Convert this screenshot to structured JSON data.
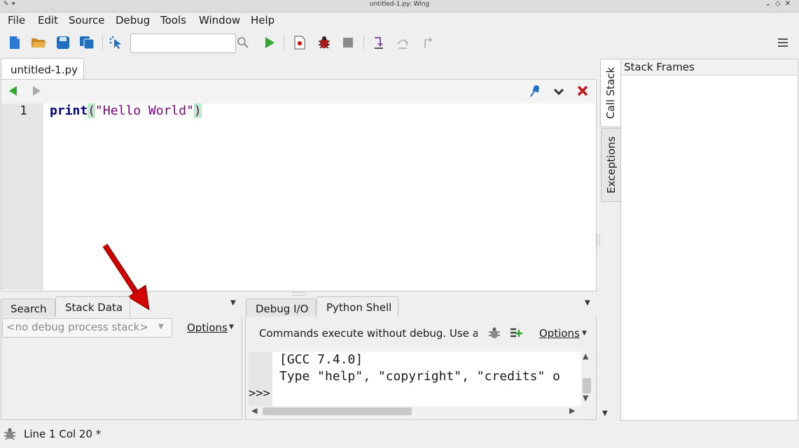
{
  "window": {
    "title": "untitled-1.py: Wing"
  },
  "menu": [
    {
      "label": "File"
    },
    {
      "label": "Edit"
    },
    {
      "label": "Source"
    },
    {
      "label": "Debug"
    },
    {
      "label": "Tools"
    },
    {
      "label": "Window"
    },
    {
      "label": "Help"
    }
  ],
  "toolbar": {
    "search_value": ""
  },
  "editor": {
    "tab": "untitled-1.py",
    "line_number": "1",
    "code": {
      "func": "print",
      "open": "(",
      "str": "\"Hello World\"",
      "close": ")"
    }
  },
  "left_panel": {
    "tabs": [
      "Search",
      "Stack Data"
    ],
    "combo_placeholder": "<no debug process stack>",
    "options": "Options"
  },
  "mid_panel": {
    "tabs": [
      "Debug I/O",
      "Python Shell"
    ],
    "info": "Commands execute without debug.  Use arı",
    "options": "Options",
    "shell_lines": [
      "[GCC 7.4.0]",
      "Type \"help\", \"copyright\", \"credits\" o"
    ],
    "prompt": ">>>"
  },
  "right_panel": {
    "tabs": [
      "Call Stack",
      "Exceptions"
    ],
    "header": "Stack Frames"
  },
  "status": {
    "text": "Line 1 Col 20 *"
  },
  "colors": {
    "accent_green": "#2fa82f",
    "annotation_red": "#d40000"
  }
}
